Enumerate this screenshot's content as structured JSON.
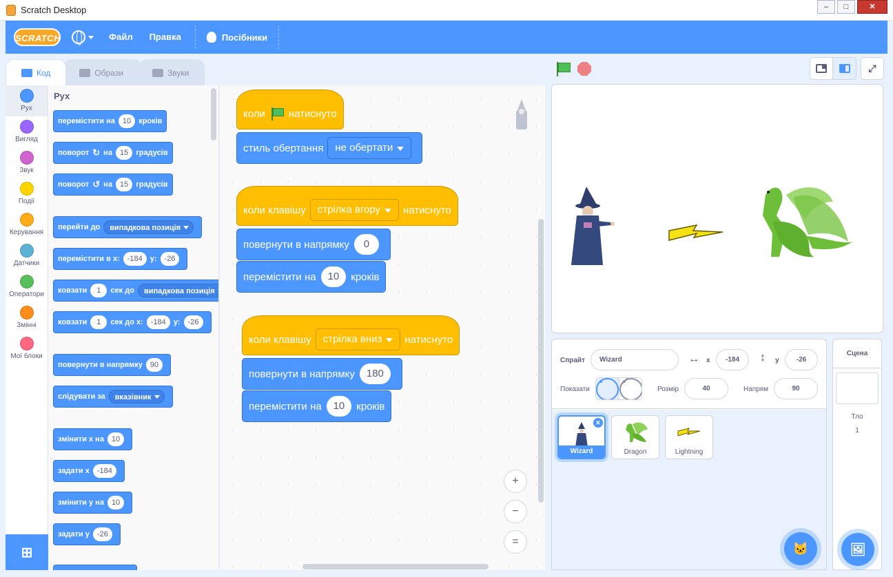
{
  "window": {
    "title": "Scratch Desktop",
    "minimize": "‒",
    "maximize": "□",
    "close": "✕"
  },
  "menubar": {
    "logo": "SCRATCH",
    "file": "Файл",
    "edit": "Правка",
    "tutorials": "Посібники"
  },
  "tabs": [
    {
      "label": "Код"
    },
    {
      "label": "Образи"
    },
    {
      "label": "Звуки"
    }
  ],
  "categories": [
    {
      "label": "Рух",
      "color": "#4c97ff"
    },
    {
      "label": "Вигляд",
      "color": "#9966ff"
    },
    {
      "label": "Звук",
      "color": "#cf63cf"
    },
    {
      "label": "Події",
      "color": "#ffd500"
    },
    {
      "label": "Керування",
      "color": "#ffab19"
    },
    {
      "label": "Датчики",
      "color": "#5cb1d6"
    },
    {
      "label": "Оператори",
      "color": "#59c059"
    },
    {
      "label": "Змінні",
      "color": "#ff8c1a"
    },
    {
      "label": "Мої блоки",
      "color": "#ff6680"
    }
  ],
  "palette": {
    "title": "Рух",
    "b1": {
      "a": "перемістити на",
      "v": "10",
      "b": "кроків"
    },
    "b2": {
      "a": "поворот",
      "icon": "↻",
      "b": "на",
      "v": "15",
      "c": "градусів"
    },
    "b3": {
      "a": "поворот",
      "icon": "↺",
      "b": "на",
      "v": "15",
      "c": "градусів"
    },
    "b4": {
      "a": "перейти до",
      "dd": "випадкова позиція"
    },
    "b5": {
      "a": "перемістити в x:",
      "x": "-184",
      "b": "y:",
      "y": "-26"
    },
    "b6": {
      "a": "ковзати",
      "v": "1",
      "b": "сек до",
      "dd": "випадкова позиція"
    },
    "b7": {
      "a": "ковзати",
      "v": "1",
      "b": "сек до x:",
      "x": "-184",
      "c": "y:",
      "y": "-26"
    },
    "b8": {
      "a": "повернути в напрямку",
      "v": "90"
    },
    "b9": {
      "a": "слідувати за",
      "dd": "вказівник"
    },
    "b10": {
      "a": "змінити x на",
      "v": "10"
    },
    "b11": {
      "a": "задати x",
      "v": "-184"
    },
    "b12": {
      "a": "змінити y на",
      "v": "10"
    },
    "b13": {
      "a": "задати y",
      "v": "-26"
    }
  },
  "scripts": {
    "s1": {
      "hat_a": "коли",
      "hat_b": "натиснуто",
      "rot_label": "стиль обертання",
      "rot_value": "не обертати"
    },
    "s2": {
      "hat_a": "коли клавішу",
      "key": "стрілка вгору",
      "hat_b": "натиснуто",
      "point_label": "повернути в напрямку",
      "point_value": "0",
      "move_a": "перемістити на",
      "move_value": "10",
      "move_b": "кроків"
    },
    "s3": {
      "hat_a": "коли клавішу",
      "key": "стрілка вниз",
      "hat_b": "натиснуто",
      "point_label": "повернути в напрямку",
      "point_value": "180",
      "move_a": "перемістити на",
      "move_value": "10",
      "move_b": "кроків"
    }
  },
  "zoom": {
    "in": "+",
    "out": "−",
    "reset": "="
  },
  "sprite_info": {
    "sprite_label": "Спрайт",
    "sprite_name": "Wizard",
    "x_label": "x",
    "x_value": "-184",
    "y_label": "y",
    "y_value": "-26",
    "show_label": "Показати",
    "size_label": "Розмір",
    "size_value": "40",
    "direction_label": "Напрям",
    "direction_value": "90"
  },
  "sprites": [
    {
      "name": "Wizard"
    },
    {
      "name": "Dragon"
    },
    {
      "name": "Lightning"
    }
  ],
  "stage_pane": {
    "title": "Сцена",
    "backdrops_label": "Тло",
    "backdrops_count": "1"
  }
}
